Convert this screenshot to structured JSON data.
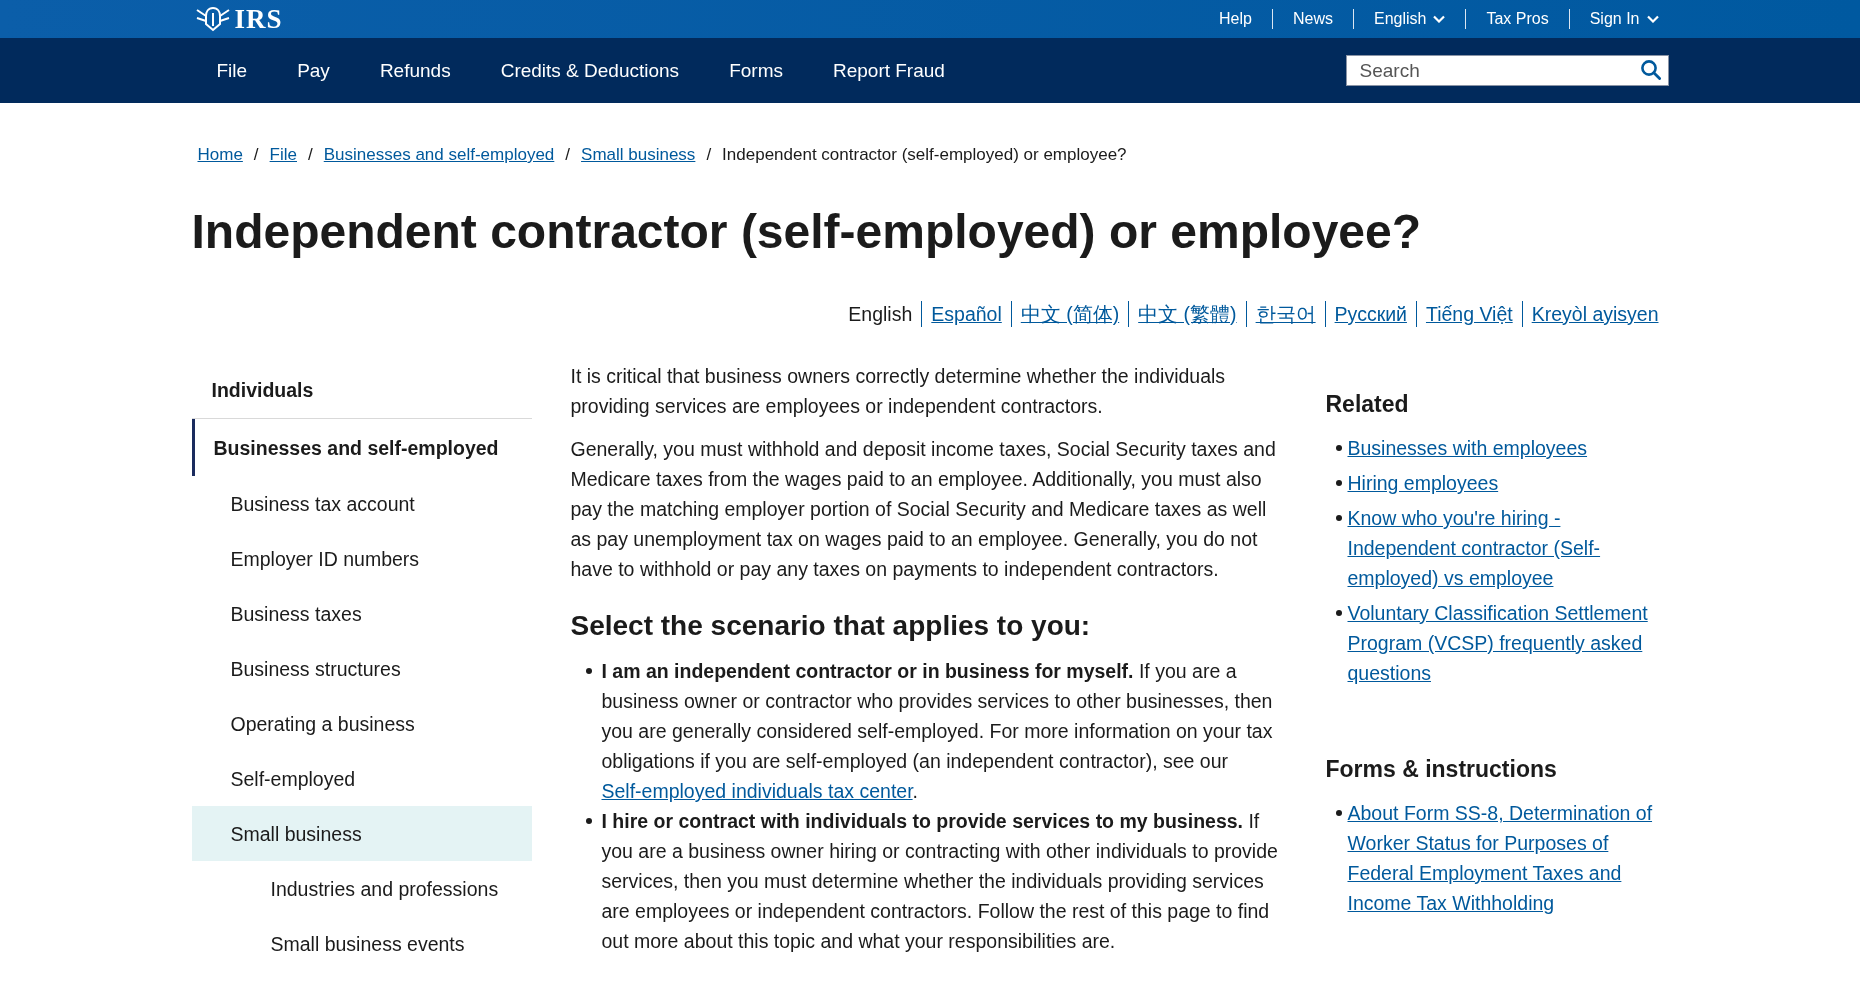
{
  "header": {
    "logo": "IRS",
    "utility_links": [
      {
        "label": "Help",
        "dropdown": false
      },
      {
        "label": "News",
        "dropdown": false
      },
      {
        "label": "English",
        "dropdown": true
      },
      {
        "label": "Tax Pros",
        "dropdown": false
      },
      {
        "label": "Sign In",
        "dropdown": true
      }
    ]
  },
  "main_nav": {
    "items": [
      "File",
      "Pay",
      "Refunds",
      "Credits & Deductions",
      "Forms",
      "Report Fraud"
    ],
    "search": {
      "placeholder": "Search"
    }
  },
  "breadcrumb": {
    "separator": "/",
    "items": [
      {
        "label": "Home",
        "current": false
      },
      {
        "label": "File",
        "current": false
      },
      {
        "label": "Businesses and self-employed",
        "current": false
      },
      {
        "label": "Small business",
        "current": false
      },
      {
        "label": "Independent contractor (self-employed) or employee?",
        "current": true
      }
    ]
  },
  "page_title": "Independent contractor (self-employed) or employee?",
  "languages": [
    {
      "label": "English",
      "selected": true
    },
    {
      "label": "Español",
      "selected": false
    },
    {
      "label": "中文 (简体)",
      "selected": false
    },
    {
      "label": "中文 (繁體)",
      "selected": false
    },
    {
      "label": "한국어",
      "selected": false
    },
    {
      "label": "Русский",
      "selected": false
    },
    {
      "label": "Tiếng Việt",
      "selected": false
    },
    {
      "label": "Kreyòl ayisyen",
      "selected": false
    }
  ],
  "sidebar": {
    "items": [
      {
        "label": "Individuals",
        "selected": false,
        "expanded": false
      },
      {
        "label": "Businesses and self-employed",
        "selected": false,
        "expanded": true,
        "children": [
          {
            "label": "Business tax account",
            "selected": false
          },
          {
            "label": "Employer ID numbers",
            "selected": false
          },
          {
            "label": "Business taxes",
            "selected": false
          },
          {
            "label": "Business structures",
            "selected": false
          },
          {
            "label": "Operating a business",
            "selected": false
          },
          {
            "label": "Self-employed",
            "selected": false
          },
          {
            "label": "Small business",
            "selected": true,
            "expanded": true,
            "children": [
              {
                "label": "Industries and professions",
                "selected": false
              },
              {
                "label": "Small business events",
                "selected": false
              }
            ]
          }
        ]
      }
    ]
  },
  "article": {
    "paragraphs": [
      "It is critical that business owners correctly determine whether the individuals providing services are employees or independent contractors.",
      "Generally, you must withhold and deposit income taxes, Social Security taxes and Medicare taxes from the wages paid to an employee. Additionally, you must also pay the matching employer portion of Social Security and Medicare taxes as well as pay unemployment tax on wages paid to an employee. Generally, you do not have to withhold or pay any taxes on payments to independent contractors."
    ],
    "heading": "Select the scenario that applies to you:",
    "scenarios": [
      {
        "text": "**I am an independent contractor or in business for myself.** If you are a business owner or contractor who provides services to other businesses, then you are generally considered self-employed. For more information on your tax obligations if you are self-employed (an independent contractor), see our ",
        "link": "Self-employed individuals tax center",
        "after": "."
      },
      {
        "text": "**I hire or contract with individuals to provide services to my business.** If you are a business owner hiring or contracting with other individuals to provide services, then you must determine whether the individuals providing services are employees or independent contractors. Follow the rest of this page to find out more about this topic and what your responsibilities are."
      }
    ]
  },
  "aside": {
    "sections": [
      {
        "title": "Related",
        "links": [
          "Businesses with employees",
          "Hiring employees",
          "Know who you're hiring - Independent contractor (Self-employed) vs employee",
          "Voluntary Classification Settlement Program (VCSP) frequently asked questions"
        ]
      },
      {
        "title": "Forms & instructions",
        "links": [
          "About Form SS-8, Determination of Worker Status for Purposes of Federal Employment Taxes and Income Tax Withholding"
        ]
      }
    ]
  }
}
